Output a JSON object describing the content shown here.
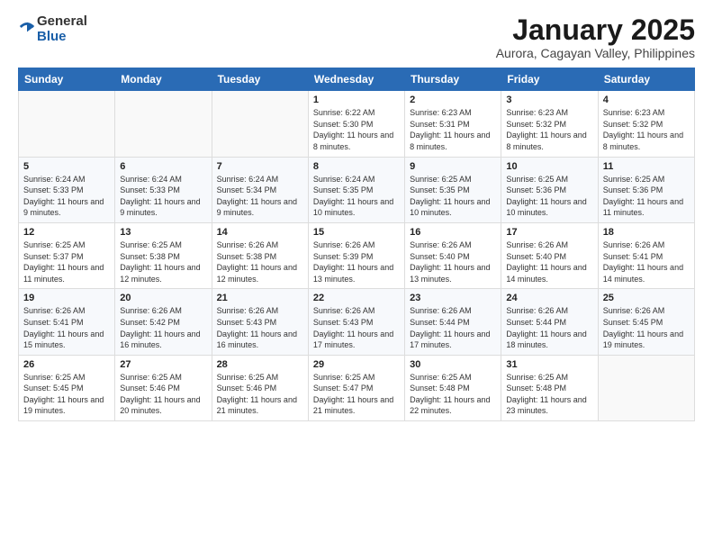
{
  "header": {
    "logo_general": "General",
    "logo_blue": "Blue",
    "month_title": "January 2025",
    "subtitle": "Aurora, Cagayan Valley, Philippines"
  },
  "weekdays": [
    "Sunday",
    "Monday",
    "Tuesday",
    "Wednesday",
    "Thursday",
    "Friday",
    "Saturday"
  ],
  "weeks": [
    [
      {
        "day": "",
        "info": ""
      },
      {
        "day": "",
        "info": ""
      },
      {
        "day": "",
        "info": ""
      },
      {
        "day": "1",
        "info": "Sunrise: 6:22 AM\nSunset: 5:30 PM\nDaylight: 11 hours and 8 minutes."
      },
      {
        "day": "2",
        "info": "Sunrise: 6:23 AM\nSunset: 5:31 PM\nDaylight: 11 hours and 8 minutes."
      },
      {
        "day": "3",
        "info": "Sunrise: 6:23 AM\nSunset: 5:32 PM\nDaylight: 11 hours and 8 minutes."
      },
      {
        "day": "4",
        "info": "Sunrise: 6:23 AM\nSunset: 5:32 PM\nDaylight: 11 hours and 8 minutes."
      }
    ],
    [
      {
        "day": "5",
        "info": "Sunrise: 6:24 AM\nSunset: 5:33 PM\nDaylight: 11 hours and 9 minutes."
      },
      {
        "day": "6",
        "info": "Sunrise: 6:24 AM\nSunset: 5:33 PM\nDaylight: 11 hours and 9 minutes."
      },
      {
        "day": "7",
        "info": "Sunrise: 6:24 AM\nSunset: 5:34 PM\nDaylight: 11 hours and 9 minutes."
      },
      {
        "day": "8",
        "info": "Sunrise: 6:24 AM\nSunset: 5:35 PM\nDaylight: 11 hours and 10 minutes."
      },
      {
        "day": "9",
        "info": "Sunrise: 6:25 AM\nSunset: 5:35 PM\nDaylight: 11 hours and 10 minutes."
      },
      {
        "day": "10",
        "info": "Sunrise: 6:25 AM\nSunset: 5:36 PM\nDaylight: 11 hours and 10 minutes."
      },
      {
        "day": "11",
        "info": "Sunrise: 6:25 AM\nSunset: 5:36 PM\nDaylight: 11 hours and 11 minutes."
      }
    ],
    [
      {
        "day": "12",
        "info": "Sunrise: 6:25 AM\nSunset: 5:37 PM\nDaylight: 11 hours and 11 minutes."
      },
      {
        "day": "13",
        "info": "Sunrise: 6:25 AM\nSunset: 5:38 PM\nDaylight: 11 hours and 12 minutes."
      },
      {
        "day": "14",
        "info": "Sunrise: 6:26 AM\nSunset: 5:38 PM\nDaylight: 11 hours and 12 minutes."
      },
      {
        "day": "15",
        "info": "Sunrise: 6:26 AM\nSunset: 5:39 PM\nDaylight: 11 hours and 13 minutes."
      },
      {
        "day": "16",
        "info": "Sunrise: 6:26 AM\nSunset: 5:40 PM\nDaylight: 11 hours and 13 minutes."
      },
      {
        "day": "17",
        "info": "Sunrise: 6:26 AM\nSunset: 5:40 PM\nDaylight: 11 hours and 14 minutes."
      },
      {
        "day": "18",
        "info": "Sunrise: 6:26 AM\nSunset: 5:41 PM\nDaylight: 11 hours and 14 minutes."
      }
    ],
    [
      {
        "day": "19",
        "info": "Sunrise: 6:26 AM\nSunset: 5:41 PM\nDaylight: 11 hours and 15 minutes."
      },
      {
        "day": "20",
        "info": "Sunrise: 6:26 AM\nSunset: 5:42 PM\nDaylight: 11 hours and 16 minutes."
      },
      {
        "day": "21",
        "info": "Sunrise: 6:26 AM\nSunset: 5:43 PM\nDaylight: 11 hours and 16 minutes."
      },
      {
        "day": "22",
        "info": "Sunrise: 6:26 AM\nSunset: 5:43 PM\nDaylight: 11 hours and 17 minutes."
      },
      {
        "day": "23",
        "info": "Sunrise: 6:26 AM\nSunset: 5:44 PM\nDaylight: 11 hours and 17 minutes."
      },
      {
        "day": "24",
        "info": "Sunrise: 6:26 AM\nSunset: 5:44 PM\nDaylight: 11 hours and 18 minutes."
      },
      {
        "day": "25",
        "info": "Sunrise: 6:26 AM\nSunset: 5:45 PM\nDaylight: 11 hours and 19 minutes."
      }
    ],
    [
      {
        "day": "26",
        "info": "Sunrise: 6:25 AM\nSunset: 5:45 PM\nDaylight: 11 hours and 19 minutes."
      },
      {
        "day": "27",
        "info": "Sunrise: 6:25 AM\nSunset: 5:46 PM\nDaylight: 11 hours and 20 minutes."
      },
      {
        "day": "28",
        "info": "Sunrise: 6:25 AM\nSunset: 5:46 PM\nDaylight: 11 hours and 21 minutes."
      },
      {
        "day": "29",
        "info": "Sunrise: 6:25 AM\nSunset: 5:47 PM\nDaylight: 11 hours and 21 minutes."
      },
      {
        "day": "30",
        "info": "Sunrise: 6:25 AM\nSunset: 5:48 PM\nDaylight: 11 hours and 22 minutes."
      },
      {
        "day": "31",
        "info": "Sunrise: 6:25 AM\nSunset: 5:48 PM\nDaylight: 11 hours and 23 minutes."
      },
      {
        "day": "",
        "info": ""
      }
    ]
  ]
}
